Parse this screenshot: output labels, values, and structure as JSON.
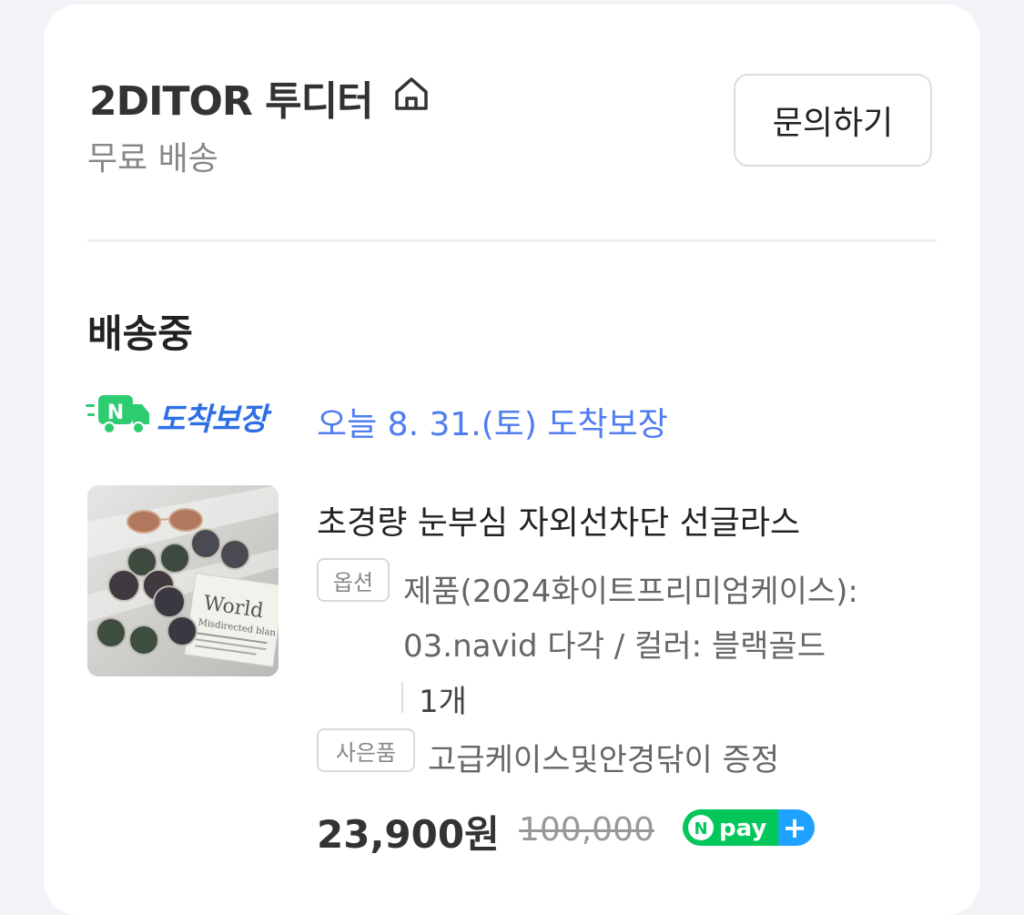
{
  "store": {
    "name": "2DITOR 투디터",
    "shipping": "무료 배송",
    "inquiry_label": "문의하기"
  },
  "order": {
    "status": "배송중",
    "arrival_badge": "도착보장",
    "arrival_text": "오늘 8. 31.(토) 도착보장"
  },
  "product": {
    "title": "초경량 눈부심 자외선차단 선글라스",
    "option_tag": "옵션",
    "option_text": "제품(2024화이트프리미엄케이스): 03.navid 다각 / 컬러: 블랙골드",
    "quantity": "1개",
    "gift_tag": "사은품",
    "gift_text": "고급케이스및안경닦이 증정",
    "price": "23,900원",
    "original_price": "100,000",
    "thumbnail_text": "World",
    "thumbnail_subtext": "Misdirected blan"
  },
  "npay": {
    "label": "pay",
    "letter": "N",
    "plus": "+"
  },
  "colors": {
    "accent_blue": "#4f7df0",
    "badge_blue": "#2e6fe6",
    "npay_green": "#03c75a",
    "npay_blue": "#1fa2ff"
  }
}
